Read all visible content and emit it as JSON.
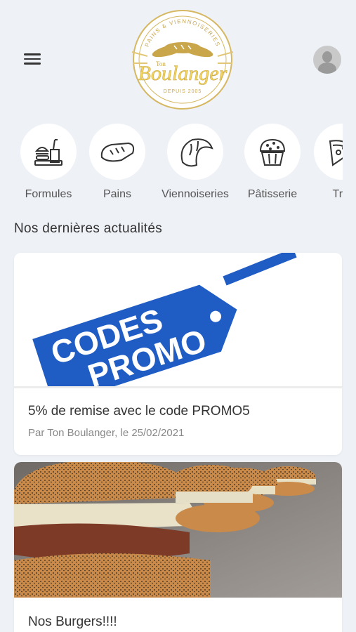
{
  "header": {
    "logo": {
      "small_text": "Ton",
      "brand": "Boulanger",
      "arc_text": "PAINS & VIENNOISERIES",
      "since": "DEPUIS 2005"
    }
  },
  "categories": [
    {
      "label": "Formules",
      "icon": "fast-food-icon"
    },
    {
      "label": "Pains",
      "icon": "bread-icon"
    },
    {
      "label": "Viennoiseries",
      "icon": "croissant-icon"
    },
    {
      "label": "Pâtisserie",
      "icon": "cupcake-icon"
    },
    {
      "label": "Trai",
      "icon": "pizza-slice-icon"
    }
  ],
  "section": {
    "title": "Nos dernières actualités"
  },
  "news": [
    {
      "title": "5% de remise avec le code PROMO5",
      "meta": "Par Ton Boulanger, le 25/02/2021",
      "image_text_1": "CODES",
      "image_text_2": "PROMO"
    },
    {
      "title": "Nos Burgers!!!!"
    }
  ],
  "colors": {
    "background": "#eef1f6",
    "logo_gold": "#c9a64a",
    "promo_blue": "#1f5cc4"
  }
}
